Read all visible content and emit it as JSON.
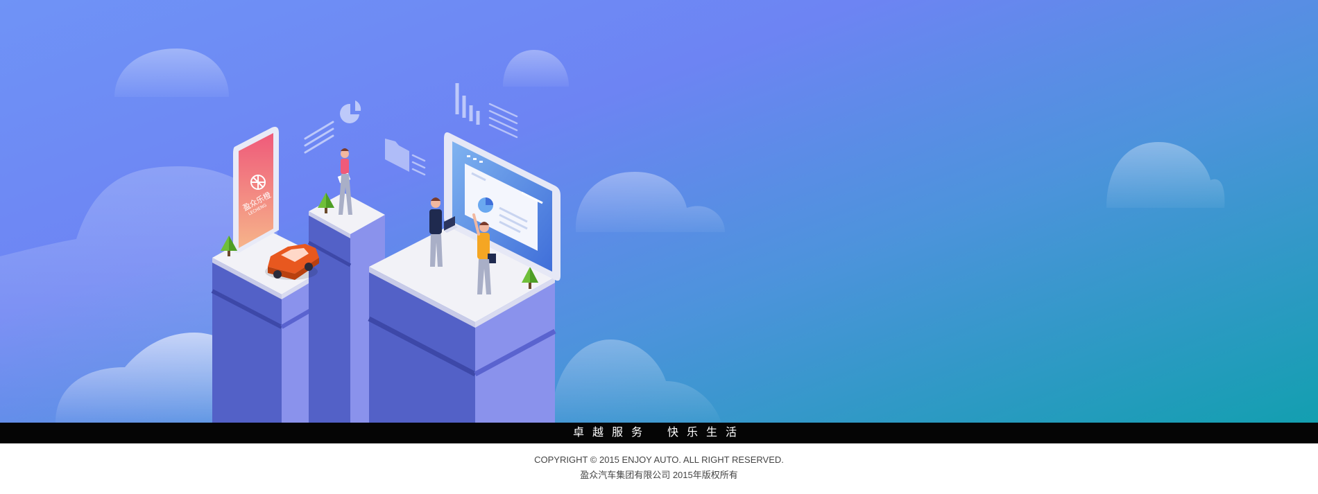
{
  "band": {
    "slogan_left": "卓越服务",
    "slogan_right": "快乐生活"
  },
  "footer": {
    "copyright": "COPYRIGHT © 2015 ENJOY AUTO. ALL RIGHT RESERVED.",
    "company": "盈众汽车集团有限公司  2015年版权所有"
  },
  "phone_app": {
    "name": "盈众乐橙",
    "sub": "LECHENG"
  },
  "colors": {
    "hero_start": "#6f93f6",
    "hero_end": "#139fb0",
    "band": "#050505",
    "phone_gradient_top": "#ef5a7a",
    "phone_gradient_bottom": "#f6b48a",
    "car": "#e8581f",
    "block_side_dark": "#5361c7",
    "block_side_light": "#8a92ec"
  },
  "icons": [
    "bar-chart-icon",
    "pie-chart-icon",
    "folder-icon",
    "lines-icon",
    "tree-icon",
    "car-icon"
  ]
}
